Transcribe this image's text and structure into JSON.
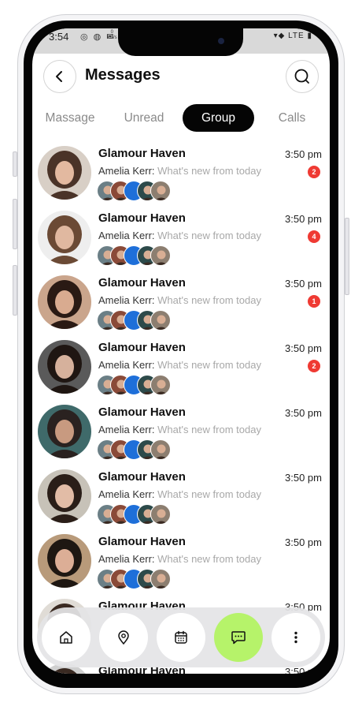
{
  "status": {
    "time": "3:54",
    "kbs_top": "0",
    "kbs_bottom": "KB/s",
    "right": "LTE"
  },
  "header": {
    "title": "Messages",
    "back_icon": "chevron-left-icon",
    "search_icon": "search-icon"
  },
  "tabs": [
    {
      "label": "Massage",
      "active": false
    },
    {
      "label": "Unread",
      "active": false
    },
    {
      "label": "Group",
      "active": true
    },
    {
      "label": "Calls",
      "active": false
    }
  ],
  "conversations": [
    {
      "name": "Glamour Haven",
      "time": "3:50 pm",
      "sender": "Amelia Kerr:",
      "message": " What's new from today",
      "badge": "2"
    },
    {
      "name": "Glamour Haven",
      "time": "3:50 pm",
      "sender": "Amelia Kerr:",
      "message": " What's new from today",
      "badge": "4"
    },
    {
      "name": "Glamour Haven",
      "time": "3:50 pm",
      "sender": "Amelia Kerr:",
      "message": " What's new from today",
      "badge": "1"
    },
    {
      "name": "Glamour Haven",
      "time": "3:50 pm",
      "sender": "Amelia Kerr:",
      "message": " What's new from today",
      "badge": "2"
    },
    {
      "name": "Glamour Haven",
      "time": "3:50 pm",
      "sender": "Amelia Kerr:",
      "message": " What's new from today",
      "badge": ""
    },
    {
      "name": "Glamour Haven",
      "time": "3:50 pm",
      "sender": "Amelia Kerr:",
      "message": " What's new from today",
      "badge": ""
    },
    {
      "name": "Glamour Haven",
      "time": "3:50 pm",
      "sender": "Amelia Kerr:",
      "message": " What's new from today",
      "badge": ""
    },
    {
      "name": "Glamour Haven",
      "time": "3:50 pm",
      "sender": "",
      "message": "",
      "badge": ""
    },
    {
      "name": "Glamour Haven",
      "time": "3:50 pm",
      "sender": "",
      "message": "",
      "badge": ""
    }
  ],
  "nav": [
    {
      "icon": "home-icon",
      "active": false
    },
    {
      "icon": "location-pin-icon",
      "active": false
    },
    {
      "icon": "calendar-icon",
      "active": false
    },
    {
      "icon": "chat-bubble-icon",
      "active": true
    },
    {
      "icon": "more-vertical-icon",
      "active": false
    }
  ],
  "colors": {
    "accent": "#b6f36a",
    "badge": "#ef3a33",
    "active_tab": "#050505"
  }
}
